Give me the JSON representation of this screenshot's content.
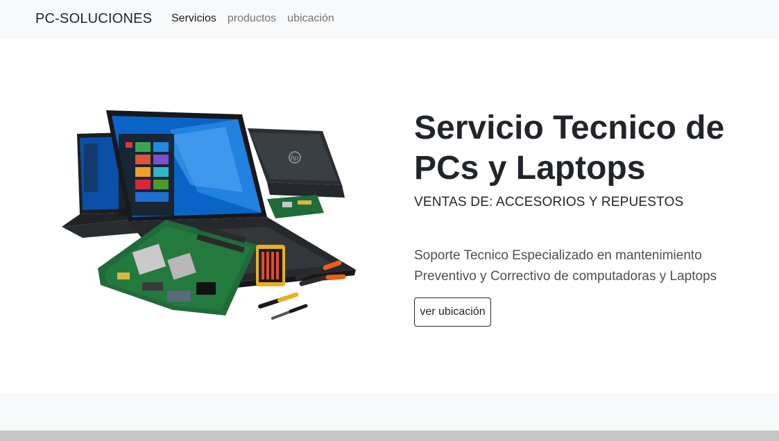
{
  "navbar": {
    "brand": "PC-SOLUCIONES",
    "links": [
      {
        "label": "Servicios",
        "active": true
      },
      {
        "label": "productos",
        "active": false
      },
      {
        "label": "ubicación",
        "active": false
      }
    ]
  },
  "hero": {
    "title": "Servicio Tecnico de PCs y Laptops",
    "subtitle": "VENTAS DE: ACCESORIOS Y REPUESTOS",
    "description": "Soporte Tecnico Especializado en mantenimiento Preventivo y Correctivo de computadoras y Laptops",
    "button_label": "ver ubicación",
    "image_icon": "laptops-and-motherboards-image",
    "laptop_logo": "hp"
  },
  "colors": {
    "navbar_bg": "#f8f9fa",
    "text": "#212529",
    "muted": "#6c757d",
    "motherboard": "#1f6b3a",
    "screen_blue": "#0a64c8"
  }
}
